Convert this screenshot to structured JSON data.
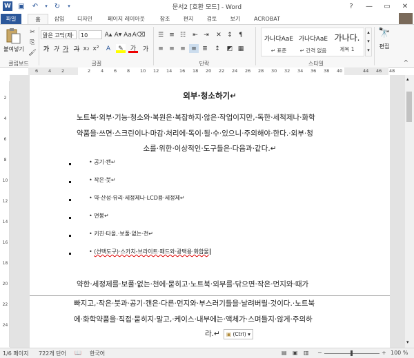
{
  "window": {
    "title": "문서2 [호환 모드] - Word"
  },
  "tabs": [
    "파일",
    "홈",
    "삽입",
    "디자인",
    "페이지 레이아웃",
    "참조",
    "편지",
    "검토",
    "보기",
    "ACROBAT"
  ],
  "ribbon": {
    "clipboard": {
      "paste_label": "붙여넣기",
      "group_label": "클립보드"
    },
    "font": {
      "font_name": "맑은 고딕(제·",
      "font_size": "10",
      "group_label": "글꼴"
    },
    "paragraph": {
      "group_label": "단락"
    },
    "styles": {
      "items": [
        {
          "preview": "가나다AaE",
          "name": "↵ 표준"
        },
        {
          "preview": "가나다AaE",
          "name": "↵ 간격 없음"
        },
        {
          "preview": "가나다.",
          "name": "제목 1"
        }
      ],
      "group_label": "스타일"
    },
    "editing": {
      "label": "편집"
    }
  },
  "ruler": {
    "h": [
      "6",
      "4",
      "2",
      "",
      "2",
      "4",
      "6",
      "8",
      "10",
      "12",
      "14",
      "16",
      "18",
      "20",
      "22",
      "24",
      "26",
      "28",
      "30",
      "32",
      "34",
      "36",
      "38",
      "40",
      "",
      "44",
      "46",
      "48"
    ]
  },
  "document": {
    "heading": "외부·청소하기↵",
    "intro": [
      "노트북·외부·기능·청소와·복원은·복잡하지·않은·작업이지만,·독한·세척제나·화학",
      "약품을·쓰면·스크린이나·마감·처리에·독이·될·수·있으니·주의해야·한다.·외부·청",
      "소를·위한·이상적인·도구들은·다음과·같다.↵"
    ],
    "list": [
      "공기·캔↵",
      "작은·붓↵",
      "약·산성·유리·세정제나·LCD용·세정제↵",
      "면봉↵",
      "키친·타올,·보풀·없는·천↵",
      "(선택도구)·스카치-브라이트·패드와·광택용·화합물"
    ],
    "para2": [
      "약한·세정제를·보풀·없는·천에·묻히고·노트북·외부를·닦으면·작은·먼지와·때가",
      "빠지고,·작은·붓과·공기·캔은·다른·먼지와·부스러기들을·날려버릴·것이다.·노트북",
      "에·화학약품을·직접·묻히지·말고,·케이스·내부에는·액체가·스며들지·않게·주의하",
      "라.↵"
    ],
    "paste_options": "(Ctrl)"
  },
  "status": {
    "page": "1/6 페이지",
    "words": "722개 단어",
    "language": "한국어",
    "zoom": "100 %"
  }
}
